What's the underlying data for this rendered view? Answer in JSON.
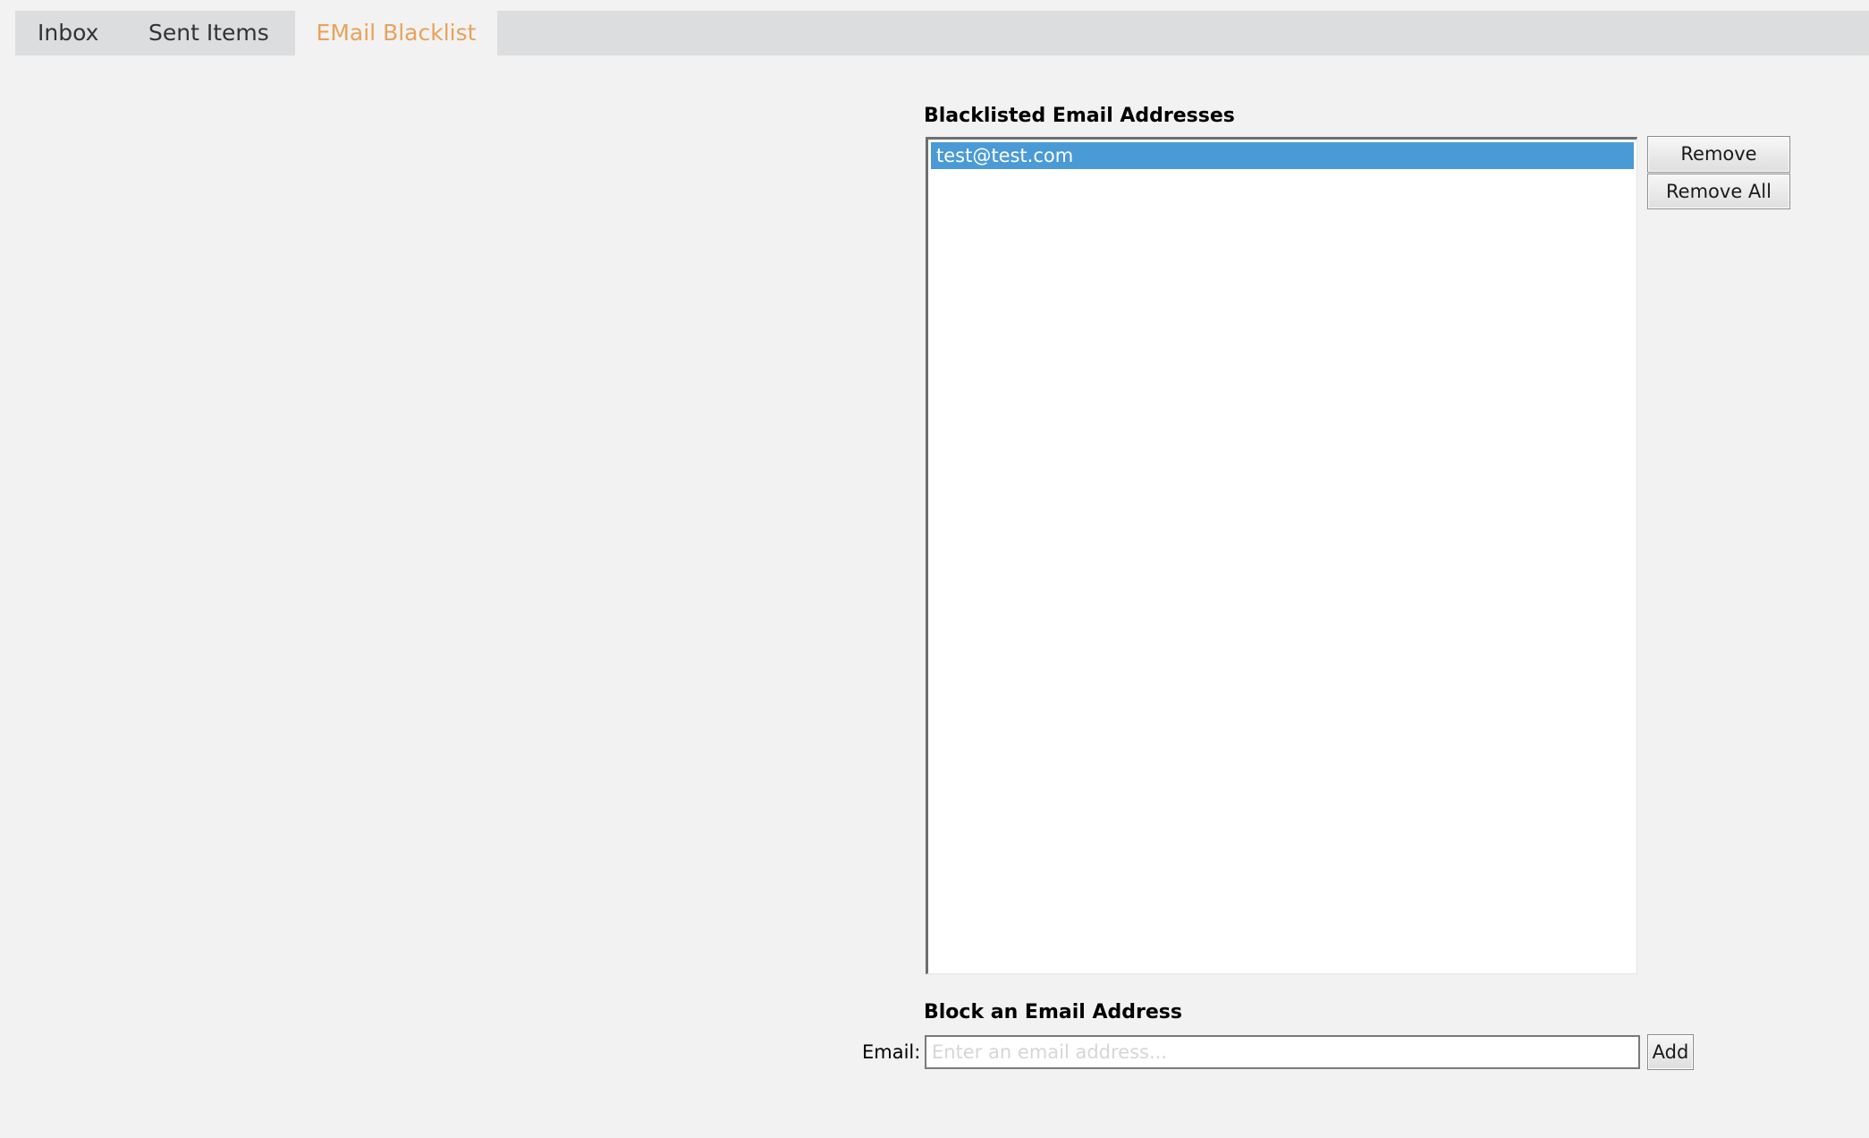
{
  "tabs": [
    {
      "label": "Inbox",
      "active": false
    },
    {
      "label": "Sent Items",
      "active": false
    },
    {
      "label": "EMail Blacklist",
      "active": true
    }
  ],
  "colors": {
    "active_tab_text": "#e8a25a",
    "selection_background": "#4a9ad6",
    "tabbar_background": "#dcdddf",
    "page_background": "#f2f2f2"
  },
  "blacklist": {
    "title": "Blacklisted Email Addresses",
    "items": [
      {
        "email": "test@test.com",
        "selected": true
      }
    ],
    "remove_label": "Remove",
    "remove_all_label": "Remove All"
  },
  "block": {
    "title": "Block an Email Address",
    "email_label": "Email:",
    "email_value": "",
    "email_placeholder": "Enter an email address...",
    "add_label": "Add"
  }
}
